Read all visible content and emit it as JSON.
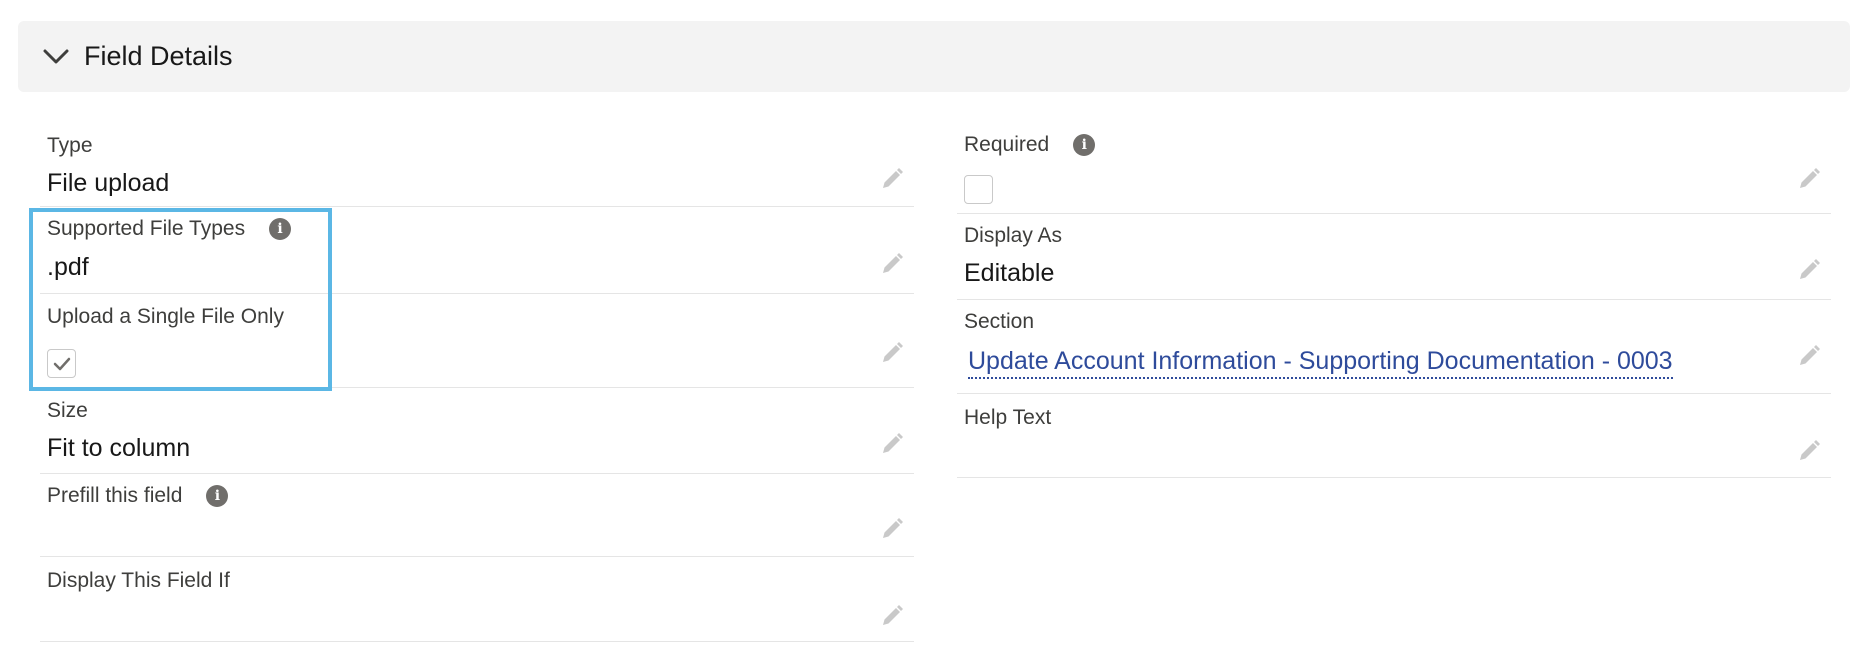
{
  "section": {
    "title": "Field Details"
  },
  "left_fields": {
    "type": {
      "label": "Type",
      "value": "File upload"
    },
    "supported_file_types": {
      "label": "Supported File Types",
      "value": ".pdf"
    },
    "upload_single": {
      "label": "Upload a Single File Only",
      "checked": true
    },
    "size": {
      "label": "Size",
      "value": "Fit to column"
    },
    "prefill": {
      "label": "Prefill this field",
      "value": ""
    },
    "display_if": {
      "label": "Display This Field If",
      "value": ""
    }
  },
  "right_fields": {
    "required": {
      "label": "Required",
      "checked": false
    },
    "display_as": {
      "label": "Display As",
      "value": "Editable"
    },
    "section": {
      "label": "Section",
      "value": "Update Account Information - Supporting Documentation - 0003"
    },
    "help_text": {
      "label": "Help Text",
      "value": ""
    }
  },
  "colors": {
    "highlight": "#5bb7e5",
    "link": "#2e4b9b",
    "header_bg": "#f3f3f3"
  }
}
